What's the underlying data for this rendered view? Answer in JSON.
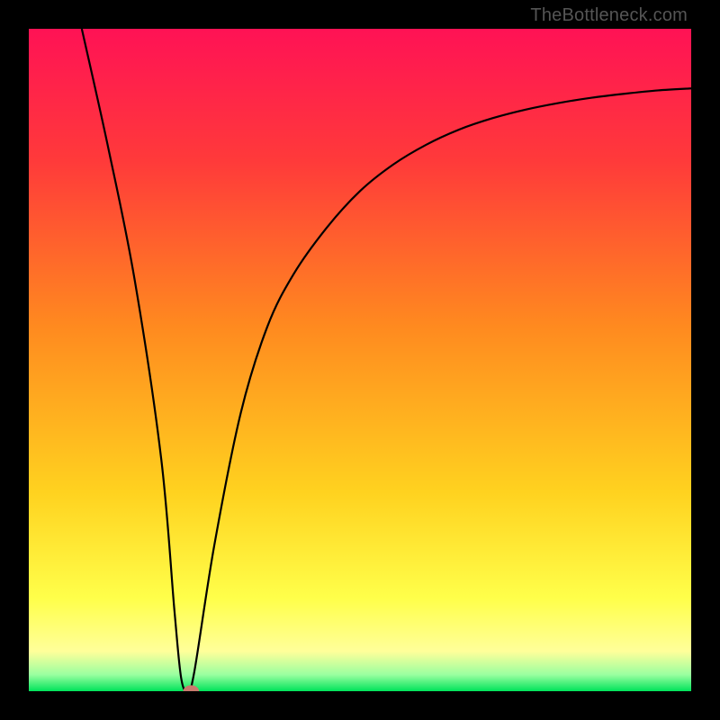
{
  "attribution": "TheBottleneck.com",
  "chart_data": {
    "type": "line",
    "title": "",
    "xlabel": "",
    "ylabel": "",
    "xlim": [
      0,
      100
    ],
    "ylim": [
      0,
      100
    ],
    "grid": false,
    "legend": false,
    "annotations": [],
    "gradient_background": {
      "orientation": "vertical",
      "stops": [
        {
          "pos": 0,
          "color": "#ff1255"
        },
        {
          "pos": 20,
          "color": "#ff3a3a"
        },
        {
          "pos": 45,
          "color": "#ff8a1f"
        },
        {
          "pos": 70,
          "color": "#ffd21f"
        },
        {
          "pos": 86,
          "color": "#ffff4a"
        },
        {
          "pos": 94,
          "color": "#ffff9a"
        },
        {
          "pos": 97.5,
          "color": "#9affa0"
        },
        {
          "pos": 100,
          "color": "#00e35b"
        }
      ]
    },
    "series": [
      {
        "name": "bottleneck-curve",
        "x": [
          8,
          12,
          16,
          20,
          22,
          23,
          24,
          25,
          28,
          32,
          36,
          40,
          45,
          50,
          55,
          60,
          65,
          70,
          75,
          80,
          85,
          90,
          95,
          100
        ],
        "y": [
          100,
          82,
          62,
          35,
          12,
          2,
          0,
          3,
          22,
          42,
          55,
          63,
          70,
          75.5,
          79.5,
          82.5,
          84.8,
          86.5,
          87.8,
          88.8,
          89.6,
          90.2,
          90.7,
          91
        ]
      }
    ],
    "marker": {
      "x": 24.5,
      "y": 0,
      "color": "#c97a6e",
      "r": 1.2
    }
  },
  "colors": {
    "frame": "#000000",
    "curve": "#000000"
  }
}
